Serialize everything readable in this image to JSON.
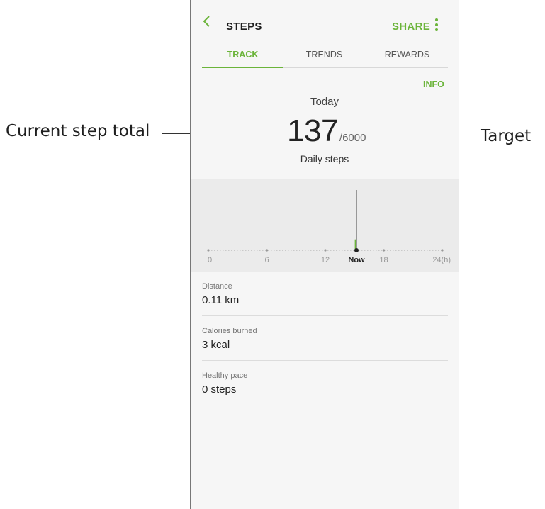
{
  "callouts": {
    "left": "Current step total",
    "right": "Target"
  },
  "app_bar": {
    "title": "STEPS",
    "share_label": "SHARE"
  },
  "tabs": [
    {
      "label": "TRACK",
      "active": true
    },
    {
      "label": "TRENDS",
      "active": false
    },
    {
      "label": "REWARDS",
      "active": false
    }
  ],
  "info_label": "INFO",
  "summary": {
    "period": "Today",
    "steps": "137",
    "target": "/6000",
    "caption": "Daily steps"
  },
  "timeline": {
    "tick_labels": [
      "0",
      "6",
      "12",
      "Now",
      "18",
      "24(h)"
    ],
    "now_hour": 15.2,
    "bar_hour": 15.1,
    "bar_level": 0.18
  },
  "stats": [
    {
      "label": "Distance",
      "value": "0.11 km"
    },
    {
      "label": "Calories burned",
      "value": "3 kcal"
    },
    {
      "label": "Healthy pace",
      "value": "0 steps"
    }
  ],
  "colors": {
    "accent": "#6bb43a",
    "chart_bg": "#ebebeb"
  }
}
